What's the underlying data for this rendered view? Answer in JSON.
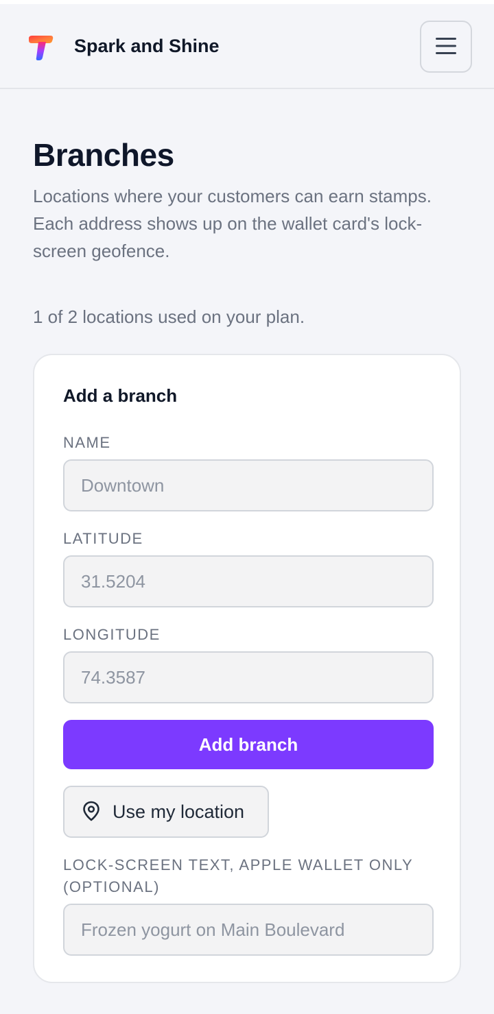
{
  "header": {
    "brand": "Spark and Shine"
  },
  "page": {
    "title": "Branches",
    "description": "Locations where your customers can earn stamps. Each address shows up on the wallet card's lock-screen geofence.",
    "usage": "1 of 2 locations used on your plan."
  },
  "form": {
    "title": "Add a branch",
    "name": {
      "label": "NAME",
      "placeholder": "Downtown",
      "value": ""
    },
    "latitude": {
      "label": "LATITUDE",
      "placeholder": "31.5204",
      "value": ""
    },
    "longitude": {
      "label": "LONGITUDE",
      "placeholder": "74.3587",
      "value": ""
    },
    "submit_label": "Add branch",
    "location_button_label": "Use my location",
    "lockscreen": {
      "label": "LOCK-SCREEN TEXT, APPLE WALLET ONLY (OPTIONAL)",
      "placeholder": "Frozen yogurt on Main Boulevard",
      "value": ""
    }
  },
  "icons": {
    "logo": "brand-logo-icon",
    "menu": "hamburger-menu-icon",
    "location": "map-pin-icon"
  },
  "colors": {
    "accent": "#7c3aff",
    "background": "#f4f5f9"
  }
}
